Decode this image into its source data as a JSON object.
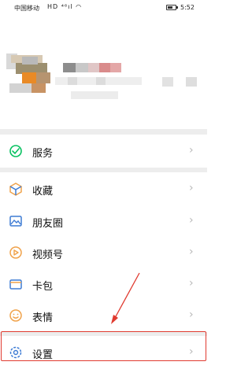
{
  "status_bar": {
    "carrier": "中国移动",
    "signal_icons": "HD ⁴⁶ıl ◠",
    "time": "5:52"
  },
  "menu": {
    "items": [
      {
        "label": "服务",
        "icon": "service-icon",
        "color": "#07c160"
      },
      {
        "label": "收藏",
        "icon": "favorites-icon",
        "color": "#f0a24a"
      },
      {
        "label": "朋友圈",
        "icon": "moments-icon",
        "color": "#3d7bd4"
      },
      {
        "label": "视频号",
        "icon": "channels-icon",
        "color": "#f0a24a"
      },
      {
        "label": "卡包",
        "icon": "cards-icon",
        "color": "#3d7bd4"
      },
      {
        "label": "表情",
        "icon": "stickers-icon",
        "color": "#f0a24a"
      },
      {
        "label": "设置",
        "icon": "settings-icon",
        "color": "#3d7bd4"
      }
    ],
    "chevron": "›"
  },
  "annotation": {
    "highlight_color": "#e03a2f"
  }
}
